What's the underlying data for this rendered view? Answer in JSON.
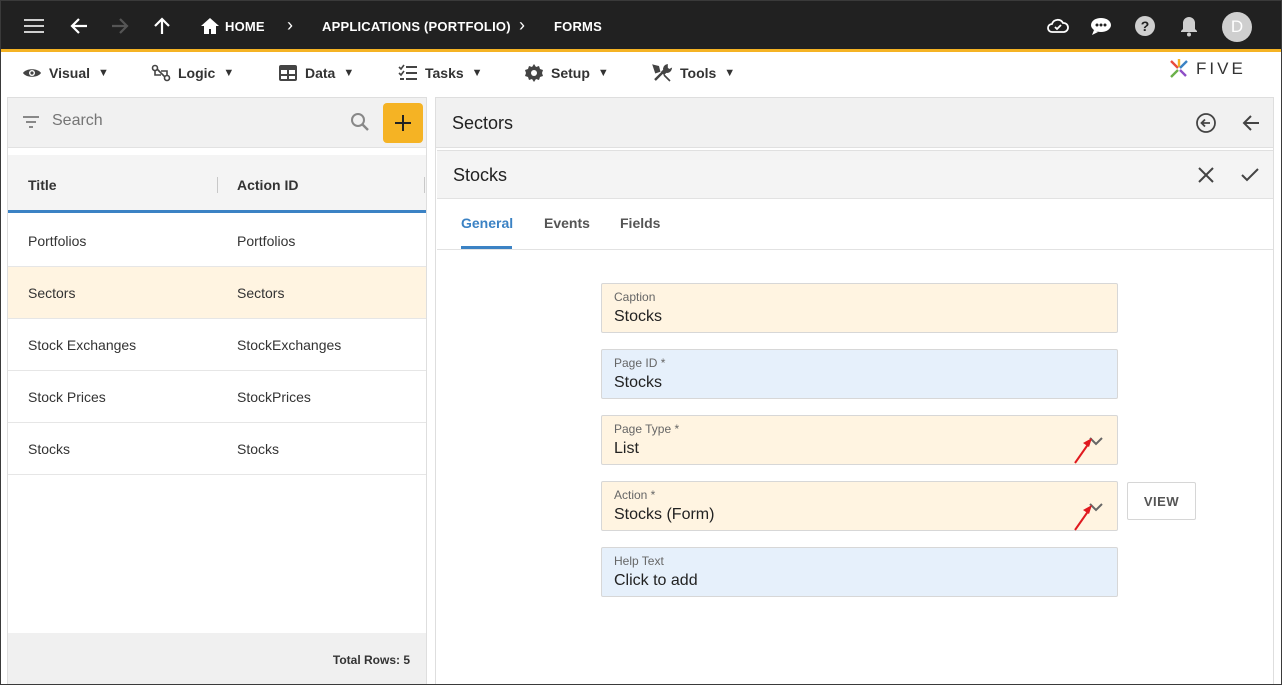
{
  "topbar": {
    "home_label": "HOME",
    "crumb_applications": "APPLICATIONS (PORTFOLIO)",
    "crumb_forms": "FORMS",
    "avatar_initial": "D",
    "accent_color": "#f5b324"
  },
  "menu": {
    "items": [
      {
        "label": "Visual",
        "icon": "eye-icon"
      },
      {
        "label": "Logic",
        "icon": "logic-icon"
      },
      {
        "label": "Data",
        "icon": "table-icon"
      },
      {
        "label": "Tasks",
        "icon": "tasks-icon"
      },
      {
        "label": "Setup",
        "icon": "gear-icon"
      },
      {
        "label": "Tools",
        "icon": "tools-icon"
      }
    ],
    "dropdown_glyph": "▼"
  },
  "logo": {
    "text": "FIVE"
  },
  "list": {
    "search_placeholder": "Search",
    "columns": [
      "Title",
      "Action ID"
    ],
    "rows": [
      {
        "title": "Portfolios",
        "action_id": "Portfolios"
      },
      {
        "title": "Sectors",
        "action_id": "Sectors"
      },
      {
        "title": "Stock Exchanges",
        "action_id": "StockExchanges"
      },
      {
        "title": "Stock Prices",
        "action_id": "StockPrices"
      },
      {
        "title": "Stocks",
        "action_id": "Stocks"
      }
    ],
    "selected_index": 1,
    "footer": "Total Rows: 5"
  },
  "detail": {
    "parent_title": "Sectors",
    "form_title": "Stocks",
    "tabs": [
      "General",
      "Events",
      "Fields"
    ],
    "active_tab": "General",
    "fields": {
      "caption": {
        "label": "Caption",
        "value": "Stocks"
      },
      "page_id": {
        "label": "Page ID *",
        "value": "Stocks"
      },
      "page_type": {
        "label": "Page Type *",
        "value": "List"
      },
      "action": {
        "label": "Action *",
        "value": "Stocks (Form)"
      },
      "help_text": {
        "label": "Help Text",
        "value": "Click to add"
      }
    },
    "view_button": "VIEW",
    "colors": {
      "yellow_field": "#fff4e1",
      "blue_field": "#e6f0fb",
      "tab_active": "#3b82c4",
      "annotation_arrow": "#e0191f"
    }
  }
}
